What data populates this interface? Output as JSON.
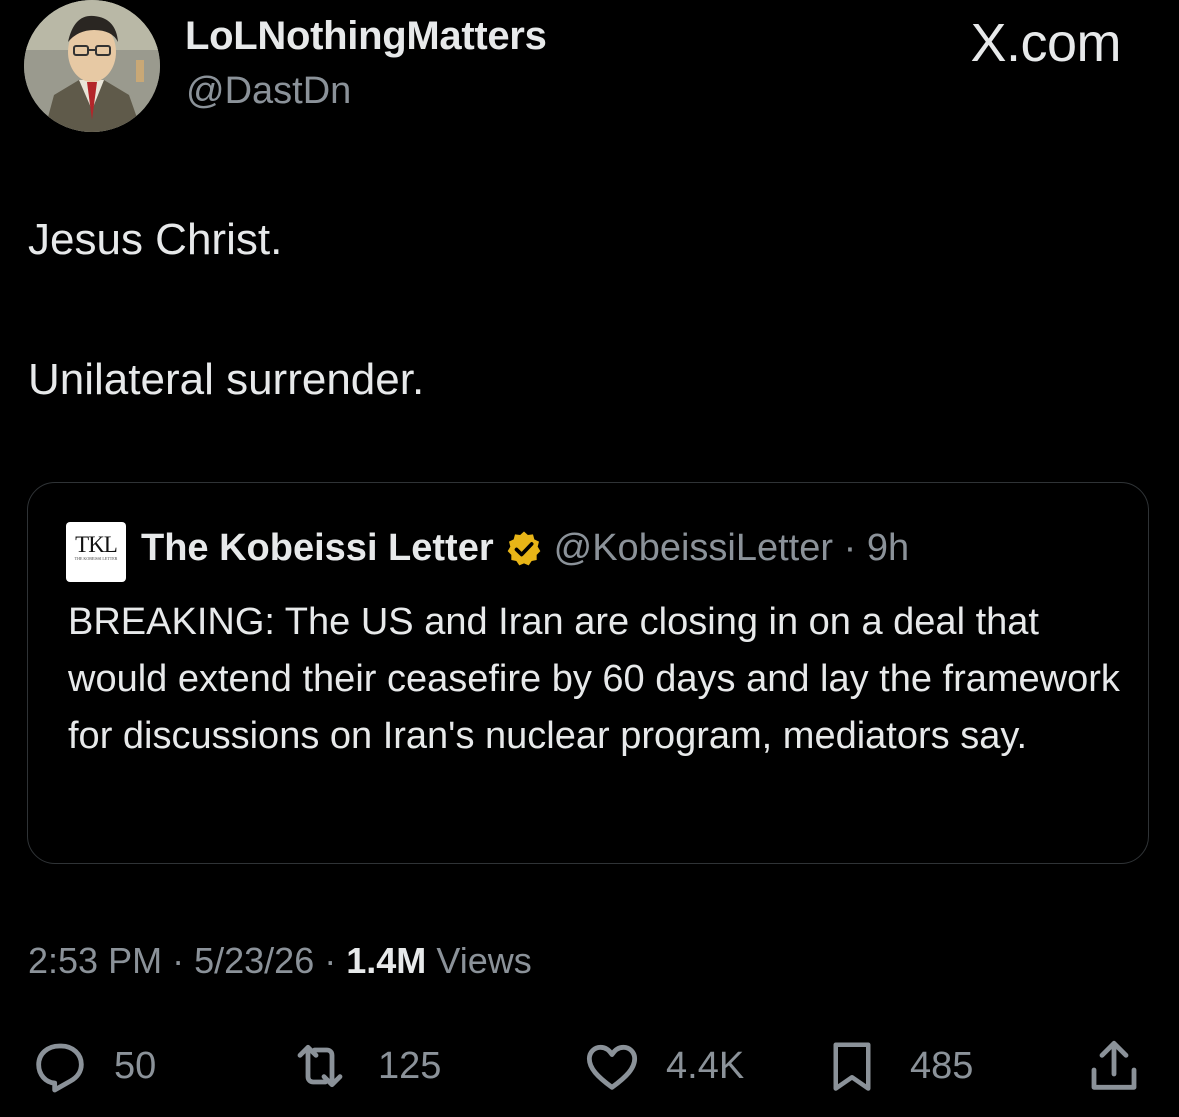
{
  "author": {
    "display_name": "LoLNothingMatters",
    "handle": "@DastDn"
  },
  "brand": "X.com",
  "tweet": {
    "paragraphs": [
      "Jesus Christ.",
      "Unilateral surrender."
    ]
  },
  "quoted": {
    "logo_text": "TKL",
    "logo_subtext": "THE KOBEISSI LETTER",
    "name": "The Kobeissi Letter",
    "handle": "@KobeissiLetter",
    "separator": "·",
    "time_ago": "9h",
    "text": "BREAKING: The US and Iran are closing in on a deal that would extend their ceasefire by 60 days and lay the framework for discussions on Iran's nuclear program, mediators say.",
    "badge_color": "#e8b517"
  },
  "meta": {
    "time": "2:53 PM",
    "sep1": "·",
    "date": "5/23/26",
    "sep2": "·",
    "views_count": "1.4M",
    "views_label": "Views"
  },
  "actions": {
    "replies": "50",
    "retweets": "125",
    "likes": "4.4K",
    "bookmarks": "485"
  },
  "icons": [
    "reply-icon",
    "retweet-icon",
    "like-icon",
    "bookmark-icon",
    "share-icon",
    "verified-badge-icon"
  ]
}
